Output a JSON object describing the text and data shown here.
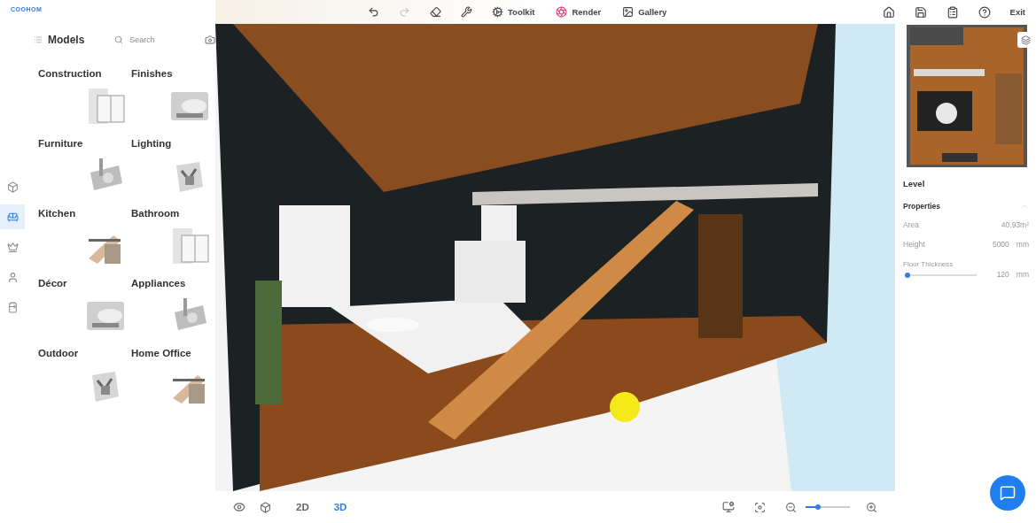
{
  "logo": "COOHOM",
  "rail": [
    {
      "selected": false
    },
    {
      "selected": true
    },
    {
      "selected": false
    },
    {
      "selected": false
    },
    {
      "selected": false
    }
  ],
  "models": {
    "title": "Models",
    "search": {
      "placeholder": "Search"
    },
    "categories": [
      {
        "label": "Construction"
      },
      {
        "label": "Finishes"
      },
      {
        "label": "Furniture"
      },
      {
        "label": "Lighting"
      },
      {
        "label": "Kitchen"
      },
      {
        "label": "Bathroom"
      },
      {
        "label": "Décor"
      },
      {
        "label": "Appliances"
      },
      {
        "label": "Outdoor"
      },
      {
        "label": "Home Office"
      }
    ]
  },
  "toolbar": {
    "left": [
      {
        "disabled": false
      },
      {
        "disabled": true
      },
      {
        "disabled": false
      },
      {
        "disabled": false
      },
      {
        "label": "Toolkit",
        "disabled": false
      },
      {
        "label": "Render",
        "disabled": false
      },
      {
        "label": "Gallery",
        "disabled": false
      }
    ],
    "right": [
      {
        "disabled": false
      },
      {
        "disabled": false
      },
      {
        "disabled": false
      },
      {
        "disabled": false
      },
      {
        "label": "Exit",
        "disabled": false
      }
    ]
  },
  "view": {
    "modes": [
      {
        "label": "2D",
        "selected": false
      },
      {
        "label": "3D",
        "selected": true
      }
    ],
    "zoom": {
      "level": 0.27
    }
  },
  "properties": {
    "level_title": "Level",
    "section": "Properties",
    "expanded": true,
    "rows": [
      {
        "kind": "value",
        "label": "Area",
        "value": "40.93m²"
      },
      {
        "kind": "value",
        "label": "Height",
        "value": "5000",
        "unit": "mm"
      },
      {
        "kind": "slider",
        "label": "Floor Thickness",
        "level": 0.02,
        "value": "120",
        "unit": "mm"
      }
    ]
  }
}
